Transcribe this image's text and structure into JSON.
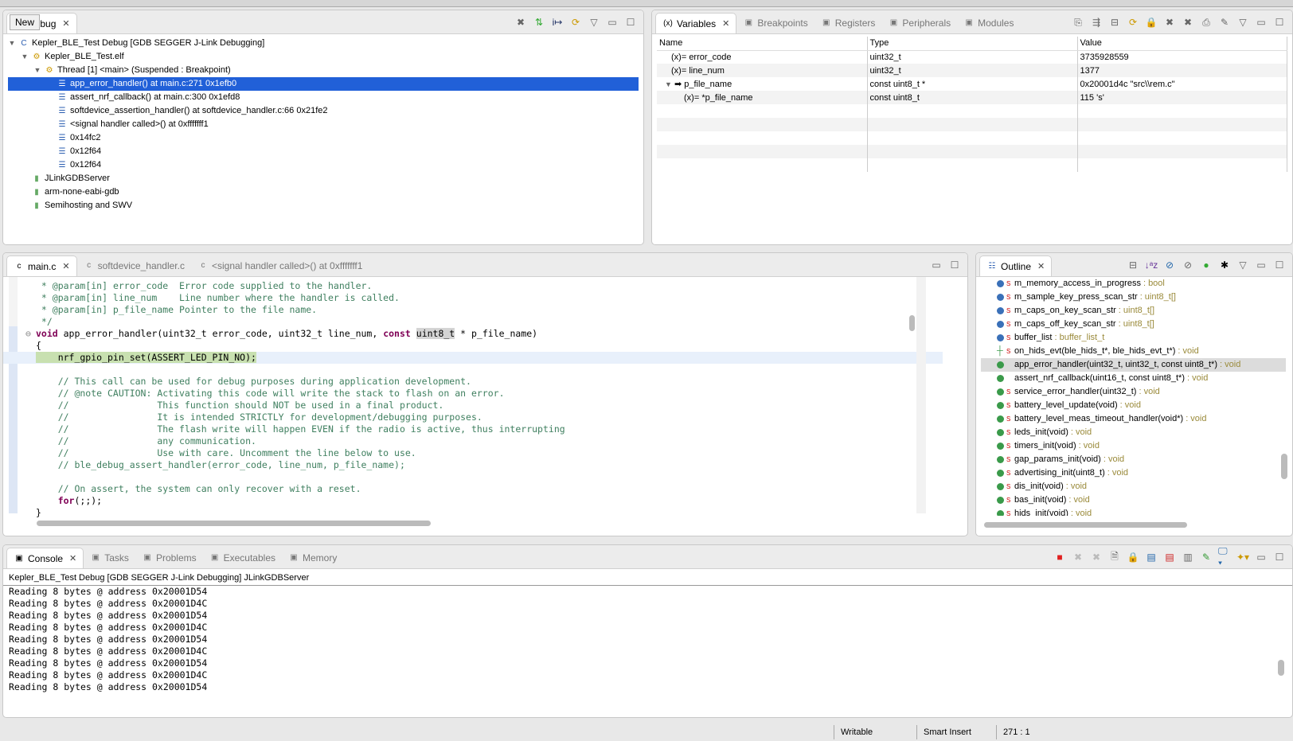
{
  "debug": {
    "tooltip": "New",
    "tab_label": "Debug",
    "tree": [
      {
        "level": 0,
        "twisty": "▼",
        "icon": "c-launch-icon",
        "label": "Kepler_BLE_Test Debug [GDB SEGGER J-Link Debugging]"
      },
      {
        "level": 1,
        "twisty": "▼",
        "icon": "elf-process-icon",
        "label": "Kepler_BLE_Test.elf"
      },
      {
        "level": 2,
        "twisty": "▼",
        "icon": "thread-icon",
        "label": "Thread [1] <main> (Suspended : Breakpoint)"
      },
      {
        "level": 3,
        "icon": "stack-frame-icon",
        "label": "app_error_handler() at main.c:271 0x1efb0",
        "selected": true
      },
      {
        "level": 3,
        "icon": "stack-frame-icon",
        "label": "assert_nrf_callback() at main.c:300 0x1efd8"
      },
      {
        "level": 3,
        "icon": "stack-frame-icon",
        "label": "softdevice_assertion_handler() at softdevice_handler.c:66 0x21fe2"
      },
      {
        "level": 3,
        "icon": "stack-frame-icon",
        "label": "<signal handler called>() at 0xfffffff1"
      },
      {
        "level": 3,
        "icon": "stack-frame-icon",
        "label": "0x14fc2"
      },
      {
        "level": 3,
        "icon": "stack-frame-icon",
        "label": "0x12f64"
      },
      {
        "level": 3,
        "icon": "stack-frame-icon",
        "label": "0x12f64"
      },
      {
        "level": 1,
        "icon": "process-icon",
        "label": "JLinkGDBServer"
      },
      {
        "level": 1,
        "icon": "process-icon",
        "label": "arm-none-eabi-gdb"
      },
      {
        "level": 1,
        "icon": "process-icon",
        "label": "Semihosting and SWV"
      }
    ]
  },
  "variables": {
    "tabs": [
      {
        "label": "Variables",
        "icon": "variables-icon",
        "active": true
      },
      {
        "label": "Breakpoints",
        "icon": "breakpoints-icon"
      },
      {
        "label": "Registers",
        "icon": "registers-icon"
      },
      {
        "label": "Peripherals",
        "icon": "peripherals-icon"
      },
      {
        "label": "Modules",
        "icon": "modules-icon"
      }
    ],
    "columns": [
      "Name",
      "Type",
      "Value"
    ],
    "rows": [
      {
        "name": "error_code",
        "type": "uint32_t",
        "value": "3735928559",
        "level": 0
      },
      {
        "name": "line_num",
        "type": "uint32_t",
        "value": "1377",
        "level": 0
      },
      {
        "name": "p_file_name",
        "type": "const uint8_t *",
        "value": "0x20001d4c \"src\\\\rem.c\"",
        "level": 0,
        "expanded": true
      },
      {
        "name": "*p_file_name",
        "type": "const uint8_t",
        "value": "115 's'",
        "level": 1
      }
    ]
  },
  "editor": {
    "tabs": [
      {
        "label": "main.c",
        "active": true
      },
      {
        "label": "softdevice_handler.c"
      },
      {
        "label": "<signal handler called>() at 0xfffffff1"
      }
    ],
    "lines": [
      [
        {
          "t": " * ",
          "c": "cm"
        },
        {
          "t": "@param",
          "c": "cm"
        },
        {
          "t": "[in] error_code  Error code supplied to the handler.",
          "c": "cm"
        }
      ],
      [
        {
          "t": " * @param[in] line_num    Line number where the handler is called.",
          "c": "cm"
        }
      ],
      [
        {
          "t": " * @param[in] p_file_name Pointer to the file name.",
          "c": "cm"
        }
      ],
      [
        {
          "t": " */",
          "c": "cm"
        }
      ],
      [
        {
          "t": "void",
          "c": "kw"
        },
        {
          "t": " app_error_handler(uint32_t error_code, uint32_t line_num, ",
          "c": "tx"
        },
        {
          "t": "const",
          "c": "kw"
        },
        {
          "t": " ",
          "c": "tx"
        },
        {
          "t": "uint8_t",
          "c": "hlw"
        },
        {
          "t": " * p_file_name)",
          "c": "tx"
        }
      ],
      [
        {
          "t": "{",
          "c": "tx"
        }
      ],
      [
        {
          "t": "    nrf_gpio_pin_set(ASSERT_LED_PIN_NO);",
          "c": "tx"
        }
      ],
      [],
      [
        {
          "t": "    // This call can be used for debug purposes during application development.",
          "c": "cm"
        }
      ],
      [
        {
          "t": "    // @note CAUTION: Activating this code will write the stack to flash on an error.",
          "c": "cm"
        }
      ],
      [
        {
          "t": "    //                This function should NOT be used in a final product.",
          "c": "cm"
        }
      ],
      [
        {
          "t": "    //                It is intended STRICTLY for development/debugging purposes.",
          "c": "cm"
        }
      ],
      [
        {
          "t": "    //                The flash write will happen EVEN if the radio is active, thus interrupting",
          "c": "cm"
        }
      ],
      [
        {
          "t": "    //                any communication.",
          "c": "cm"
        }
      ],
      [
        {
          "t": "    //                Use with care. Uncomment the line below to use.",
          "c": "cm"
        }
      ],
      [
        {
          "t": "    // ble_debug_assert_handler(error_code, line_num, p_file_name);",
          "c": "cm"
        }
      ],
      [],
      [
        {
          "t": "    // On assert, the system can only recover with a reset.",
          "c": "cm"
        }
      ],
      [
        {
          "t": "    ",
          "c": "tx"
        },
        {
          "t": "for",
          "c": "kw"
        },
        {
          "t": "(;;);",
          "c": "tx"
        }
      ],
      [
        {
          "t": "}",
          "c": "tx"
        }
      ]
    ]
  },
  "outline": {
    "tab_label": "Outline",
    "items": [
      {
        "name": "m_memory_access_in_progress",
        "type": " : bool",
        "kind": "field",
        "static": true
      },
      {
        "name": "m_sample_key_press_scan_str",
        "type": " : uint8_t[]",
        "kind": "field",
        "static": true
      },
      {
        "name": "m_caps_on_key_scan_str",
        "type": " : uint8_t[]",
        "kind": "field",
        "static": true
      },
      {
        "name": "m_caps_off_key_scan_str",
        "type": " : uint8_t[]",
        "kind": "field",
        "static": true
      },
      {
        "name": "buffer_list",
        "type": " : buffer_list_t",
        "kind": "field",
        "static": true
      },
      {
        "name": "on_hids_evt(ble_hids_t*, ble_hids_evt_t*)",
        "type": " : void",
        "kind": "decl",
        "static": true
      },
      {
        "name": "app_error_handler(uint32_t, uint32_t, const uint8_t*)",
        "type": " : void",
        "kind": "func",
        "selected": true
      },
      {
        "name": "assert_nrf_callback(uint16_t, const uint8_t*)",
        "type": " : void",
        "kind": "func"
      },
      {
        "name": "service_error_handler(uint32_t)",
        "type": " : void",
        "kind": "func",
        "static": true
      },
      {
        "name": "battery_level_update(void)",
        "type": " : void",
        "kind": "func",
        "static": true
      },
      {
        "name": "battery_level_meas_timeout_handler(void*)",
        "type": " : void",
        "kind": "func",
        "static": true
      },
      {
        "name": "leds_init(void)",
        "type": " : void",
        "kind": "func",
        "static": true
      },
      {
        "name": "timers_init(void)",
        "type": " : void",
        "kind": "func",
        "static": true
      },
      {
        "name": "gap_params_init(void)",
        "type": " : void",
        "kind": "func",
        "static": true
      },
      {
        "name": "advertising_init(uint8_t)",
        "type": " : void",
        "kind": "func",
        "static": true
      },
      {
        "name": "dis_init(void)",
        "type": " : void",
        "kind": "func",
        "static": true
      },
      {
        "name": "bas_init(void)",
        "type": " : void",
        "kind": "func",
        "static": true
      },
      {
        "name": "hids_init(void)",
        "type": " : void",
        "kind": "func",
        "static": true
      }
    ]
  },
  "console": {
    "tabs": [
      {
        "label": "Console",
        "active": true,
        "icon": "console-icon"
      },
      {
        "label": "Tasks",
        "icon": "tasks-icon"
      },
      {
        "label": "Problems",
        "icon": "problems-icon"
      },
      {
        "label": "Executables",
        "icon": "executables-icon"
      },
      {
        "label": "Memory",
        "icon": "memory-icon"
      }
    ],
    "title": "Kepler_BLE_Test Debug [GDB SEGGER J-Link Debugging] JLinkGDBServer",
    "lines": [
      "Reading 8 bytes @ address 0x20001D54",
      "Reading 8 bytes @ address 0x20001D4C",
      "Reading 8 bytes @ address 0x20001D54",
      "Reading 8 bytes @ address 0x20001D4C",
      "Reading 8 bytes @ address 0x20001D54",
      "Reading 8 bytes @ address 0x20001D4C",
      "Reading 8 bytes @ address 0x20001D54",
      "Reading 8 bytes @ address 0x20001D4C",
      "Reading 8 bytes @ address 0x20001D54"
    ]
  },
  "status": {
    "writable": "Writable",
    "insert_mode": "Smart Insert",
    "position": "271 : 1"
  },
  "colors": {
    "selection": "#2160d8",
    "current_line": "#c8e0b0",
    "comment": "#3f7f5f",
    "keyword": "#7f0055",
    "terminate": "#e02020"
  }
}
